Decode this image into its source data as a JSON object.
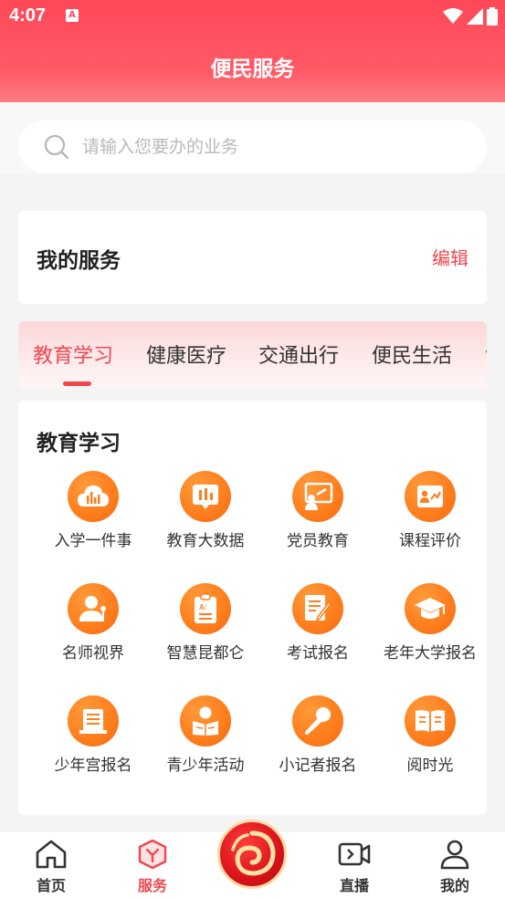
{
  "status": {
    "time": "4:07",
    "notif_glyph": "A"
  },
  "header": {
    "title": "便民服务"
  },
  "search": {
    "placeholder": "请输入您要办的业务"
  },
  "my_service": {
    "title": "我的服务",
    "edit": "编辑"
  },
  "tabs": [
    {
      "label": "教育学习",
      "active": true
    },
    {
      "label": "健康医疗"
    },
    {
      "label": "交通出行"
    },
    {
      "label": "便民生活"
    }
  ],
  "education": {
    "title": "教育学习",
    "items": [
      {
        "label": "入学一件事",
        "icon": "cloud-chart-icon"
      },
      {
        "label": "教育大数据",
        "icon": "data-chart-icon"
      },
      {
        "label": "党员教育",
        "icon": "presentation-icon"
      },
      {
        "label": "课程评价",
        "icon": "review-icon"
      },
      {
        "label": "名师视界",
        "icon": "teacher-icon"
      },
      {
        "label": "智慧昆都仑",
        "icon": "clipboard-icon"
      },
      {
        "label": "考试报名",
        "icon": "exam-icon"
      },
      {
        "label": "老年大学报名",
        "icon": "graduation-cap-icon"
      },
      {
        "label": "少年宫报名",
        "icon": "building-icon"
      },
      {
        "label": "青少年活动",
        "icon": "reader-icon"
      },
      {
        "label": "小记者报名",
        "icon": "microphone-icon"
      },
      {
        "label": "阅时光",
        "icon": "book-icon"
      }
    ]
  },
  "bottom_nav": [
    {
      "label": "首页",
      "icon": "home-icon"
    },
    {
      "label": "服务",
      "icon": "cube-icon",
      "active": true
    },
    {
      "label": "直播",
      "icon": "video-icon"
    },
    {
      "label": "我的",
      "icon": "user-icon"
    }
  ],
  "colors": {
    "accent": "#f0474f",
    "header": "#ff4858",
    "icon_orange": "#ff7f1e"
  }
}
